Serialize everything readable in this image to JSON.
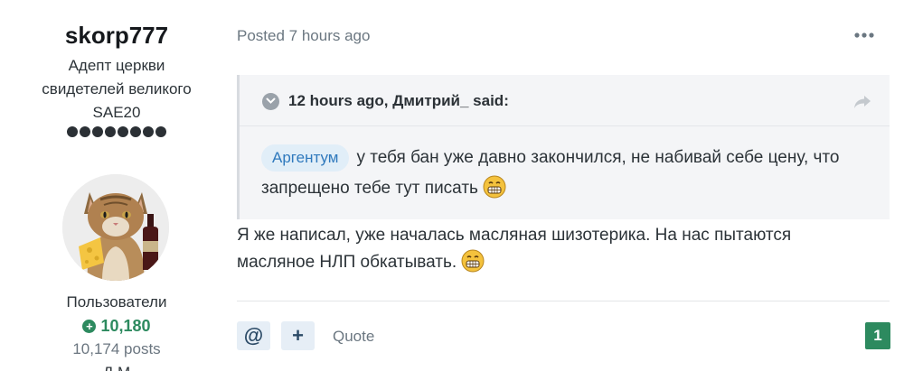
{
  "author": {
    "name": "skorp777",
    "title": [
      "Адепт церкви",
      "свидетелей великого",
      "SAE20"
    ],
    "rank_dots": 8,
    "group": "Пользователи",
    "reputation": "10,180",
    "posts": "10,174 posts",
    "extra_line": "Д М"
  },
  "post": {
    "posted": "Posted 7 hours ago",
    "menu_icon": "ellipsis-icon",
    "quote": {
      "citation": "12 hours ago, Дмитрий_ said:",
      "mention": "Аргентум",
      "body": "у тебя бан уже давно закончился, не набивай себе цену, что запрещено тебе тут писать"
    },
    "reply": "Я же написал, уже началась масляная шизотерика. На нас пытаются масляное НЛП обкатывать.",
    "actions": {
      "mention_label": "@",
      "multiquote_label": "+",
      "quote_label": "Quote"
    },
    "reaction_count": "1"
  },
  "colors": {
    "reputation": "#2d8a5f",
    "mention_bg": "#e1eef8",
    "mention_text": "#2f79bd",
    "quote_bg": "#f4f5f7"
  }
}
